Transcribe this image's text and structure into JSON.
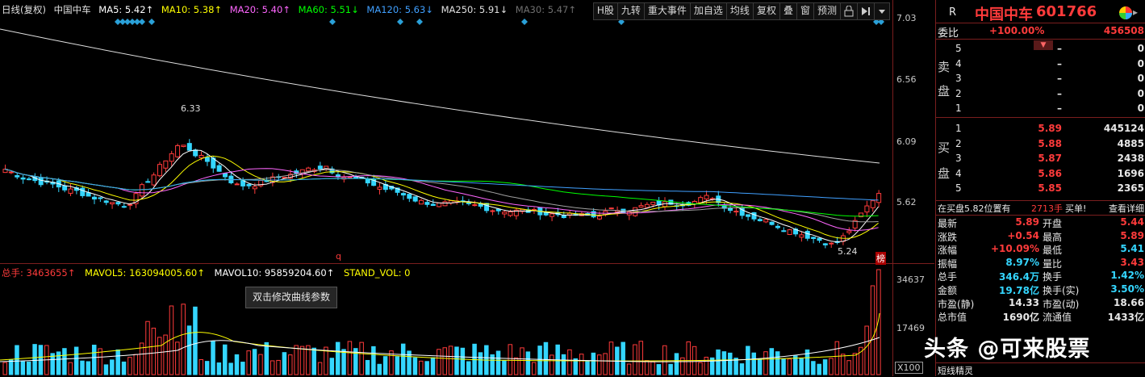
{
  "legend": {
    "title": "日线(复权)",
    "stock": "中国中车",
    "ma5": "MA5: 5.42↑",
    "ma10": "MA10: 5.38↑",
    "ma20": "MA20: 5.40↑",
    "ma60": "MA60: 5.51↓",
    "ma120": "MA120: 5.63↓",
    "ma250": "MA250: 5.91↓",
    "ma30": "MA30: 5.47↑"
  },
  "toolbar": [
    "H股",
    "九转",
    "重大事件",
    "加自选",
    "均线",
    "复权",
    "叠",
    "窗",
    "预测"
  ],
  "price_axis": [
    "7.03",
    "6.56",
    "6.09",
    "5.62"
  ],
  "vol_axis": [
    "34637",
    "17469",
    "X100"
  ],
  "annotations": {
    "high_label": "6.33",
    "low_label": "5.24",
    "peak_marker": "q",
    "tag": "榜"
  },
  "vol_legend": {
    "total": "总手: 3463655↑",
    "mavol5": "MAVOL5: 163094005.60↑",
    "mavol10": "MAVOL10: 95859204.60↑",
    "stand": "STAND_VOL: 0"
  },
  "tooltip": "双击修改曲线参数",
  "side": {
    "r_label": "R",
    "name": "中国中车",
    "code": "601766",
    "weibi_label": "委比",
    "weibi_pct": "+100.00%",
    "weibi_val": "456508",
    "sell_label_1": "卖",
    "sell_label_2": "盘",
    "buy_label_1": "买",
    "buy_label_2": "盘",
    "sell": [
      {
        "lv": "5",
        "price": "–",
        "vol": "0"
      },
      {
        "lv": "4",
        "price": "–",
        "vol": "0"
      },
      {
        "lv": "3",
        "price": "–",
        "vol": "0"
      },
      {
        "lv": "2",
        "price": "–",
        "vol": "0"
      },
      {
        "lv": "1",
        "price": "–",
        "vol": "0"
      }
    ],
    "buy": [
      {
        "lv": "1",
        "price": "5.89",
        "vol": "445124"
      },
      {
        "lv": "2",
        "price": "5.88",
        "vol": "4885"
      },
      {
        "lv": "3",
        "price": "5.87",
        "vol": "2438"
      },
      {
        "lv": "4",
        "price": "5.86",
        "vol": "1696"
      },
      {
        "lv": "5",
        "price": "5.85",
        "vol": "2365"
      }
    ],
    "buy_note": "在买盘5.82位置有",
    "buy_note_vol": "2713手",
    "buy_note_tag": "买单!",
    "buy_note_link": "查看详细",
    "stats": [
      {
        "l1": "最新",
        "v1": "5.89",
        "l2": "开盘",
        "v2": "5.44"
      },
      {
        "l1": "涨跌",
        "v1": "+0.54",
        "l2": "最高",
        "v2": "5.89"
      },
      {
        "l1": "涨幅",
        "v1": "+10.09%",
        "l2": "最低",
        "v2": "5.41"
      },
      {
        "l1": "振幅",
        "v1": "8.97%",
        "l2": "量比",
        "v2": "3.43"
      },
      {
        "l1": "总手",
        "v1": "346.4万",
        "l2": "换手",
        "v2": "1.42%"
      },
      {
        "l1": "金额",
        "v1": "19.78亿",
        "l2": "换手(实)",
        "v2": "3.50%"
      },
      {
        "l1": "市盈(静)",
        "v1": "14.33",
        "l2": "市盈(动)",
        "v2": "18.66"
      },
      {
        "l1": "总市值",
        "v1": "1690亿",
        "l2": "流通值",
        "v2": "1433亿"
      }
    ],
    "bottom_label": "短线精灵"
  },
  "watermark": "头条 @可来股票",
  "colors": {
    "up": "#ff3b3b",
    "down": "#34d6ff",
    "ma5": "#ffffff",
    "ma10": "#ffff00",
    "ma20": "#ff66ff",
    "ma60": "#00ff00",
    "ma120": "#40a0ff",
    "ma250": "#e0e0e0",
    "ma30": "#a0a0a0",
    "accent": "#7a1e1e"
  }
}
